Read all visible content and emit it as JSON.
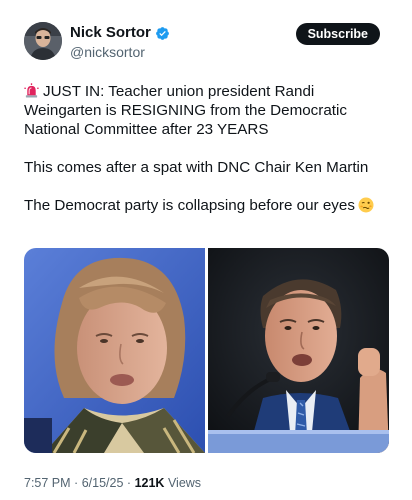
{
  "author": {
    "display_name": "Nick Sortor",
    "handle": "@nicksortor",
    "verified": true,
    "verified_color": "#1d9bf0"
  },
  "subscribe_label": "Subscribe",
  "tweet": {
    "line1": "JUST IN: Teacher union president Randi Weingarten is RESIGNING from the Democratic National Committee after 23 YEARS",
    "line2": "This comes after a spat with DNC Chair Ken Martin",
    "line3": "The Democrat party is collapsing before our eyes",
    "leading_icon": "siren-emoji",
    "trailing_icon": "woozy-face-emoji"
  },
  "media": {
    "photo_left": "woman-portrait-photo",
    "photo_right": "man-speaking-photo"
  },
  "meta": {
    "time": "7:57 PM",
    "separator": "·",
    "date": "6/15/25",
    "views_count": "121K",
    "views_label": "Views"
  }
}
